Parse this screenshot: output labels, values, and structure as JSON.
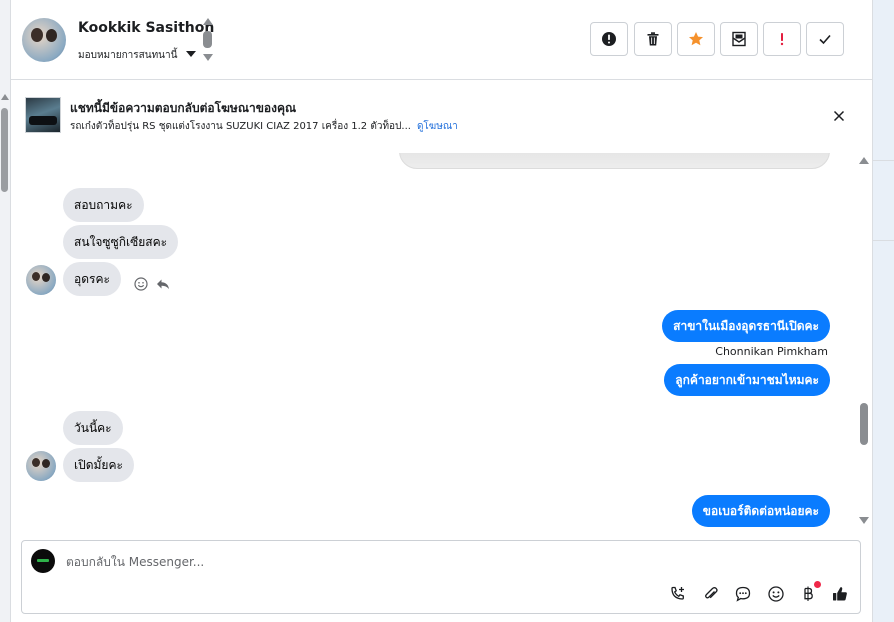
{
  "header": {
    "contact_name": "Kookkik Sasithon",
    "assign_label": "มอบหมายการสนทนานี้",
    "actions": [
      {
        "name": "mark-spam-button",
        "icon": "alert-circle-icon"
      },
      {
        "name": "delete-button",
        "icon": "trash-icon"
      },
      {
        "name": "star-button",
        "icon": "star-icon"
      },
      {
        "name": "mark-unread-button",
        "icon": "envelope-icon"
      },
      {
        "name": "flag-important-button",
        "icon": "exclamation-icon"
      },
      {
        "name": "mark-done-button",
        "icon": "check-icon"
      }
    ]
  },
  "ad_banner": {
    "title": "แชทนี้มีข้อความตอบกลับต่อโฆษณาของคุณ",
    "description": "รถเก๋งตัวท็อปรุ่น RS ชุดแต่งโรงงาน SUZUKI CIAZ 2017 เครื่อง 1.2 ตัวท็อป...",
    "link_label": "ดูโฆษณา"
  },
  "messages": [
    {
      "direction": "in",
      "text": "สอบถามคะ"
    },
    {
      "direction": "in",
      "text": "สนใจซูซูกิเซียสคะ"
    },
    {
      "direction": "in",
      "text": "อุดรคะ"
    },
    {
      "direction": "out",
      "text": "สาขาในเมืองอุดรธานีเปิดคะ"
    },
    {
      "direction": "out",
      "text": "ลูกค้าอยากเข้ามาชมไหมคะ",
      "sender": "Chonnikan Pimkham"
    },
    {
      "direction": "in",
      "text": "วันนี้คะ"
    },
    {
      "direction": "in",
      "text": "เปิดมั้ยคะ"
    },
    {
      "direction": "out",
      "text": "ขอเบอร์ติดต่อหน่อยคะ"
    }
  ],
  "composer": {
    "placeholder": "ตอบกลับใน Messenger...",
    "tools": [
      "phone-plus-icon",
      "paperclip-icon",
      "chat-bubble-icon",
      "emoji-icon",
      "baht-icon",
      "thumbs-up-icon"
    ]
  },
  "colors": {
    "outgoing_bubble": "#0a7cff",
    "incoming_bubble": "#e4e6eb",
    "star": "#f5912c",
    "flag": "#e41e3f",
    "link": "#216fdb",
    "notification_dot": "#f02849"
  }
}
